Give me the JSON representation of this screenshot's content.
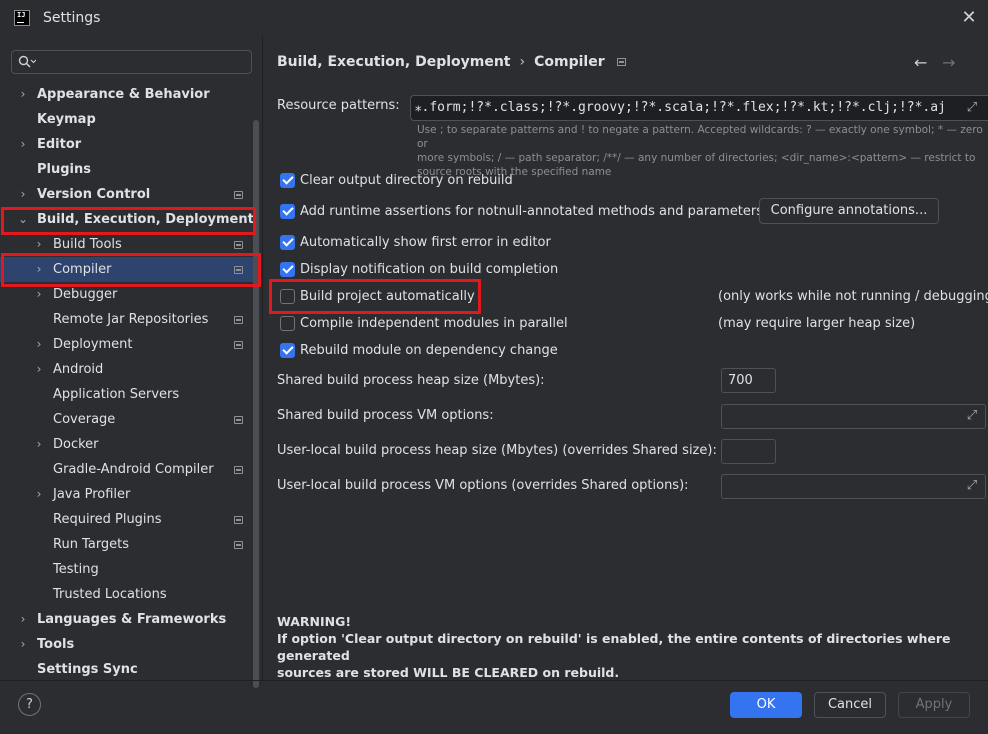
{
  "window": {
    "title": "Settings",
    "app_logo": "IJ"
  },
  "search": {
    "placeholder": ""
  },
  "sidebar": {
    "items": [
      {
        "label": "Appearance & Behavior",
        "chevron": "›"
      },
      {
        "label": "Keymap"
      },
      {
        "label": "Editor",
        "chevron": "›"
      },
      {
        "label": "Plugins"
      },
      {
        "label": "Version Control",
        "chevron": "›"
      },
      {
        "label": "Build, Execution, Deployment",
        "chevron": "⌄"
      },
      {
        "label": "Build Tools",
        "chevron": "›"
      },
      {
        "label": "Compiler",
        "chevron": "›"
      },
      {
        "label": "Debugger",
        "chevron": "›"
      },
      {
        "label": "Remote Jar Repositories"
      },
      {
        "label": "Deployment",
        "chevron": "›"
      },
      {
        "label": "Android",
        "chevron": "›"
      },
      {
        "label": "Application Servers"
      },
      {
        "label": "Coverage"
      },
      {
        "label": "Docker",
        "chevron": "›"
      },
      {
        "label": "Gradle-Android Compiler"
      },
      {
        "label": "Java Profiler",
        "chevron": "›"
      },
      {
        "label": "Required Plugins"
      },
      {
        "label": "Run Targets"
      },
      {
        "label": "Testing"
      },
      {
        "label": "Trusted Locations"
      },
      {
        "label": "Languages & Frameworks",
        "chevron": "›"
      },
      {
        "label": "Tools",
        "chevron": "›"
      },
      {
        "label": "Settings Sync"
      }
    ]
  },
  "breadcrumb": {
    "parent": "Build, Execution, Deployment",
    "separator": "›",
    "current": "Compiler"
  },
  "nav": {
    "back": "←",
    "forward": "→"
  },
  "resource_patterns": {
    "label": "Resource patterns:",
    "value": "⁎.form;!?*.class;!?*.groovy;!?*.scala;!?*.flex;!?*.kt;!?*.clj;!?*.aj",
    "hint_line1": "Use ; to separate patterns and ! to negate a pattern. Accepted wildcards: ? — exactly one symbol; * — zero or",
    "hint_line2": "more symbols; / — path separator; /**/ — any number of directories; <dir_name>:<pattern> — restrict to",
    "hint_line3": "source roots with the specified name"
  },
  "checkboxes": [
    {
      "label": "Clear output directory on rebuild",
      "checked": true
    },
    {
      "label": "Add runtime assertions for notnull-annotated methods and parameters",
      "checked": true
    },
    {
      "label": "Automatically show first error in editor",
      "checked": true
    },
    {
      "label": "Display notification on build completion",
      "checked": true
    },
    {
      "label": "Build project automatically",
      "checked": false,
      "note": "(only works while not running / debugging"
    },
    {
      "label": "Compile independent modules in parallel",
      "checked": false,
      "note": "(may require larger heap size)"
    },
    {
      "label": "Rebuild module on dependency change",
      "checked": true
    }
  ],
  "configure_annotations_label": "Configure annotations...",
  "fields": {
    "heap_label": "Shared build process heap size (Mbytes):",
    "heap_value": "700",
    "vm_label": "Shared build process VM options:",
    "vm_value": "",
    "local_heap_label": "User-local build process heap size (Mbytes) (overrides Shared size):",
    "local_heap_value": "",
    "local_vm_label": "User-local build process VM options (overrides Shared options):",
    "local_vm_value": ""
  },
  "warning": {
    "title": "WARNING!",
    "line1": "If option 'Clear output directory on rebuild' is enabled, the entire contents of directories where generated",
    "line2": "sources are stored WILL BE CLEARED on rebuild."
  },
  "footer": {
    "help": "?",
    "ok": "OK",
    "cancel": "Cancel",
    "apply": "Apply"
  },
  "colors": {
    "accent": "#3574f0",
    "selection": "#2e436e",
    "highlight": "#e1191e",
    "background": "#2b2d30"
  },
  "icons": [
    "close-icon",
    "search-icon",
    "expand-icon",
    "project-level-icon",
    "help-icon"
  ]
}
